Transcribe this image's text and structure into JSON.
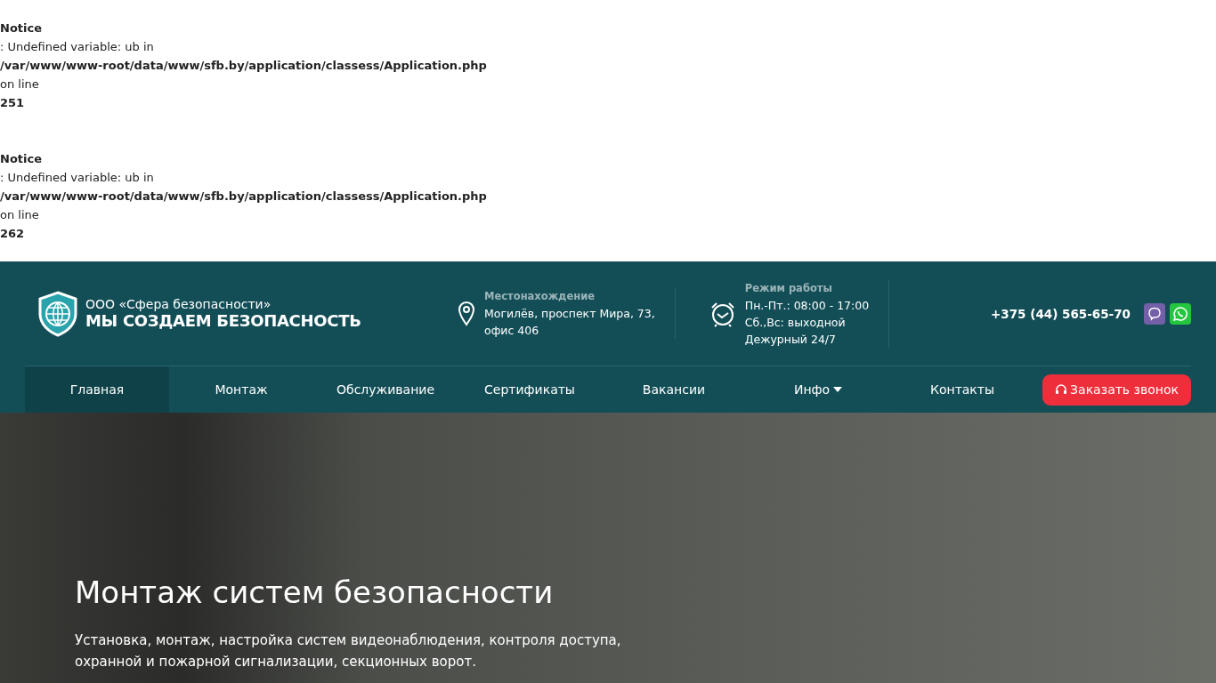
{
  "notices": [
    {
      "title": "Notice",
      "message": ": Undefined variable: ub in",
      "file": "/var/www/www-root/data/www/sfb.by/application/classess/Application.php",
      "line_label": "on line",
      "line": "251"
    },
    {
      "title": "Notice",
      "message": ": Undefined variable: ub in",
      "file": "/var/www/www-root/data/www/sfb.by/application/classess/Application.php",
      "line_label": "on line",
      "line": "262"
    }
  ],
  "header": {
    "company": "ООО «Сфера безопасности»",
    "slogan": "МЫ СОЗДАЕМ БЕЗОПАСНОСТЬ",
    "location": {
      "label": "Местонахождение",
      "lines": [
        "Могилёв, проспект Мира, 73,",
        "офис 406"
      ]
    },
    "hours": {
      "label": "Режим работы",
      "lines": [
        "Пн.-Пт.: 08:00 - 17:00",
        "Сб.,Вс: выходной",
        "Дежурный 24/7"
      ]
    },
    "phone": "+375 (44) 565-65-70"
  },
  "nav": {
    "items": [
      {
        "label": "Главная",
        "selected": true,
        "dropdown": false
      },
      {
        "label": "Монтаж",
        "selected": false,
        "dropdown": false
      },
      {
        "label": "Обслуживание",
        "selected": false,
        "dropdown": false
      },
      {
        "label": "Сертификаты",
        "selected": false,
        "dropdown": false
      },
      {
        "label": "Вакансии",
        "selected": false,
        "dropdown": false
      },
      {
        "label": "Инфо",
        "selected": false,
        "dropdown": true
      },
      {
        "label": "Контакты",
        "selected": false,
        "dropdown": false
      }
    ],
    "cta": "Заказать звонок"
  },
  "hero": {
    "title": "Монтаж систем безопасности",
    "text": "Установка, монтаж, настройка систем видеонаблюдения, контроля доступа, охранной и пожарной сигнализации, секционных ворот."
  }
}
